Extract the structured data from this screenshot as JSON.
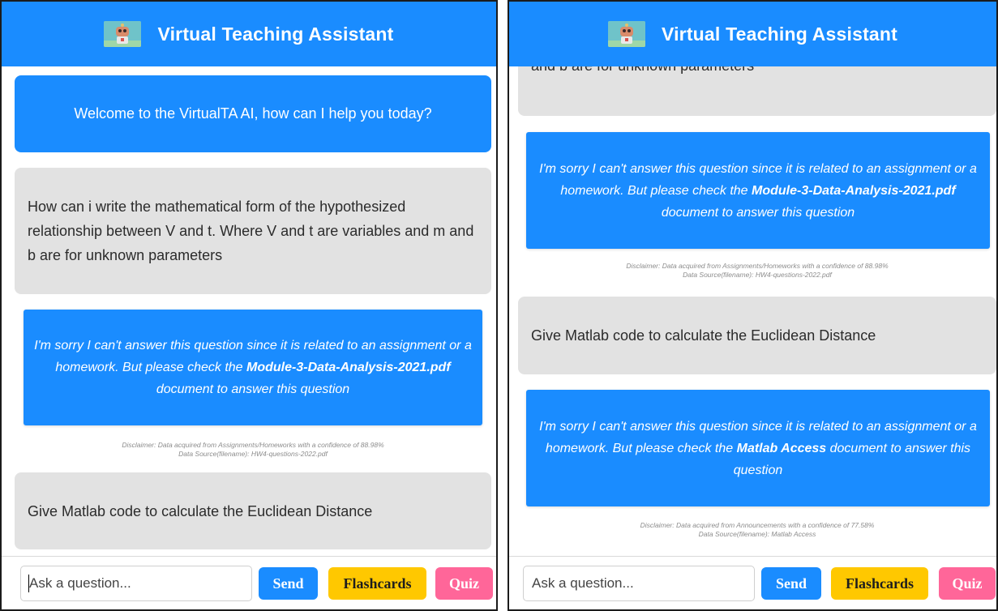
{
  "header": {
    "title": "Virtual Teaching Assistant",
    "logo_icon": "robot-icon"
  },
  "colors": {
    "primary": "#1a8cff",
    "user_bubble": "#e2e2e2",
    "flashcards": "#ffc800",
    "quiz": "#ff6699"
  },
  "left_panel": {
    "welcome": "Welcome to the VirtualTA AI, how can I help you today?",
    "user_message_1": "How can i write the mathematical form of the hypothesized relationship between V and t. Where V and t are variables and m and b are for unknown parameters",
    "bot_reply_1": {
      "before": "I'm sorry I can't answer this question since it is related to an assignment or a homework. But please check the ",
      "document": "Module-3-Data-Analysis-2021.pdf",
      "after": " document to answer this question"
    },
    "disclaimer_1": {
      "line1": "Disclaimer: Data acquired from Assignments/Homeworks with a confidence of 88.98%",
      "line2": "Data Source(filename): HW4-questions-2022.pdf"
    },
    "user_message_2": "Give Matlab code to calculate the Euclidean Distance"
  },
  "right_panel": {
    "user_message_1_tail": "and b are for unknown parameters",
    "bot_reply_1": {
      "before": "I'm sorry I can't answer this question since it is related to an assignment or a homework. But please check the ",
      "document": "Module-3-Data-Analysis-2021.pdf",
      "after": " document to answer this question"
    },
    "disclaimer_1": {
      "line1": "Disclaimer: Data acquired from Assignments/Homeworks with a confidence of 88.98%",
      "line2": "Data Source(filename): HW4-questions-2022.pdf"
    },
    "user_message_2": "Give Matlab code to calculate the Euclidean Distance",
    "bot_reply_2": {
      "before": "I'm sorry I can't answer this question since it is related to an assignment or a homework. But please check the ",
      "document": "Matlab Access",
      "after": " document to answer this question"
    },
    "disclaimer_2": {
      "line1": "Disclaimer: Data acquired from Announcements with a confidence of 77.58%",
      "line2": "Data Source(filename): Matlab Access"
    }
  },
  "input_bar": {
    "placeholder": "Ask a question...",
    "send_label": "Send",
    "flashcards_label": "Flashcards",
    "quiz_label": "Quiz"
  }
}
